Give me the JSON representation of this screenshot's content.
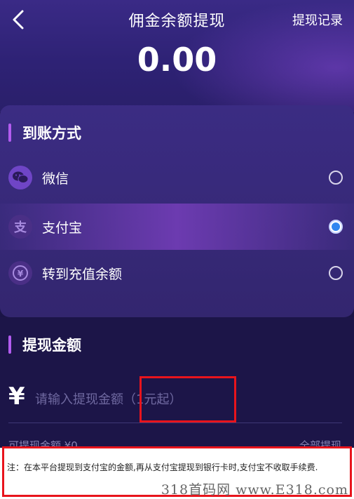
{
  "header": {
    "title": "佣金余额提现",
    "record_link": "提现记录",
    "balance": "0.00",
    "back_icon": "chevron-left-icon"
  },
  "method_section": {
    "title": "到账方式",
    "options": [
      {
        "label": "微信",
        "icon": "wechat-icon",
        "selected": false
      },
      {
        "label": "支付宝",
        "icon": "alipay-icon",
        "selected": true
      },
      {
        "label": "转到充值余额",
        "icon": "yen-refresh-icon",
        "selected": false
      }
    ]
  },
  "amount_section": {
    "title": "提现金额",
    "currency_symbol": "¥",
    "input_placeholder": "请输入提现金额（1元起）",
    "input_value": "",
    "available_label": "可提现金额 ¥0",
    "withdraw_all_label": "全部提现"
  },
  "note": {
    "text": "注：在本平台提现到支付宝的金额,再从支付宝提现到银行卡时,支付宝不收取手续费."
  },
  "watermark": "318首码网 www.E318.com",
  "colors": {
    "header_bg": "#2e2275",
    "card_bg": "#3b2c83",
    "accent_bar": "#b35cf0",
    "radio_selected": "#2f86f0",
    "highlight_box": "#e8141c",
    "page_bg": "#1c1548"
  }
}
